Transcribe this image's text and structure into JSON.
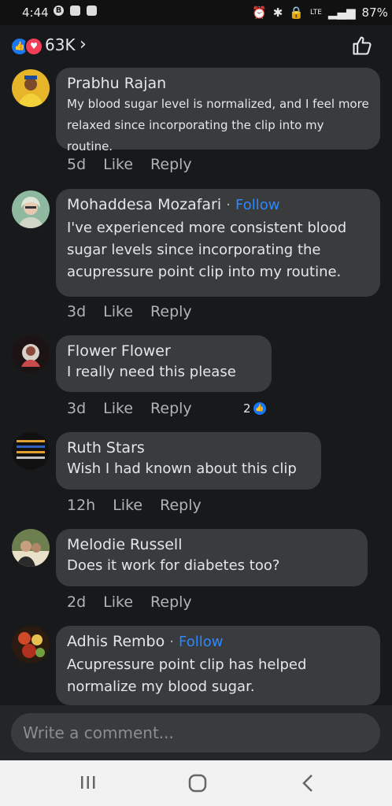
{
  "status": {
    "time": "4:44",
    "left_badge": "B",
    "network": "LTE",
    "battery": "87%"
  },
  "reactions": {
    "count": "63K",
    "chevron": "›"
  },
  "comments": [
    {
      "name": "Prabhu Rajan",
      "follow": "",
      "text": "My blood sugar level is normalized, and I feel more\nrelaxed since incorporating the clip into my routine.",
      "time": "5d",
      "like": "Like",
      "reply": "Reply",
      "avatar_color": "#e7b52a"
    },
    {
      "name": "Mohaddesa Mozafari",
      "follow": "Follow",
      "text": "I've experienced more consistent blood\nsugar levels since incorporating the\nacupressure point clip into my routine.",
      "time": "3d",
      "like": "Like",
      "reply": "Reply",
      "avatar_color": "#8fb8a0"
    },
    {
      "name": "Flower Flower",
      "follow": "",
      "text": "I really need this please",
      "time": "3d",
      "like": "Like",
      "reply": "Reply",
      "reaction_count": "2",
      "avatar_color": "#3b2a2a"
    },
    {
      "name": "Ruth Stars",
      "follow": "",
      "text": "Wish I had known about this clip",
      "time": "12h",
      "like": "Like",
      "reply": "Reply",
      "avatar_color": "#111111"
    },
    {
      "name": "Melodie Russell",
      "follow": "",
      "text": "Does it work for diabetes too?",
      "time": "2d",
      "like": "Like",
      "reply": "Reply",
      "avatar_color": "#6d7f4e"
    },
    {
      "name": "Adhis Rembo",
      "follow": "Follow",
      "text": "Acupressure point clip has helped\nnormalize my blood sugar.",
      "time": "",
      "like": "",
      "reply": "",
      "avatar_color": "#a84a30"
    }
  ],
  "composer": {
    "placeholder": "Write a comment..."
  },
  "colors": {
    "background": "#18191a",
    "bubble": "#3a3b3c",
    "accent": "#2d88ff"
  }
}
